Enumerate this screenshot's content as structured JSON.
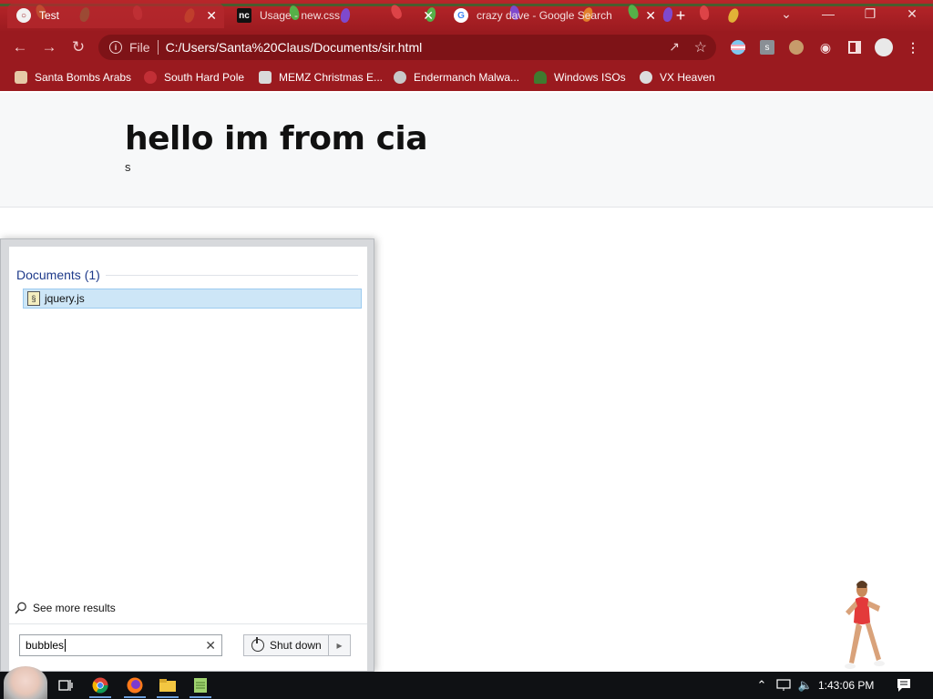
{
  "browser": {
    "tabs": [
      {
        "label": "Test",
        "active": true
      },
      {
        "label": "Usage - new.css",
        "favicon_text": "nc"
      },
      {
        "label": "crazy dave - Google Search",
        "favicon_text": "G"
      }
    ],
    "new_tab_symbol": "+",
    "url_scheme": "File",
    "url": "C:/Users/Santa%20Claus/Documents/sir.html",
    "bookmarks": [
      "Santa Bombs Arabs",
      "South Hard Pole",
      "MEMZ Christmas E...",
      "Endermanch Malwa...",
      "Windows ISOs",
      "VX Heaven"
    ]
  },
  "page": {
    "title": "hello im from cia",
    "subtitle": "s"
  },
  "start_menu": {
    "section_header": "Documents (1)",
    "result_file": "jquery.js",
    "see_more": "See more results",
    "search_value": "bubbles",
    "shutdown_label": "Shut down"
  },
  "taskbar": {
    "clock": "1:43:06 PM"
  },
  "colors": {
    "chrome_red": "#9a1a1f",
    "selection_blue": "#cde6f7",
    "taskbar": "#0f1114"
  }
}
